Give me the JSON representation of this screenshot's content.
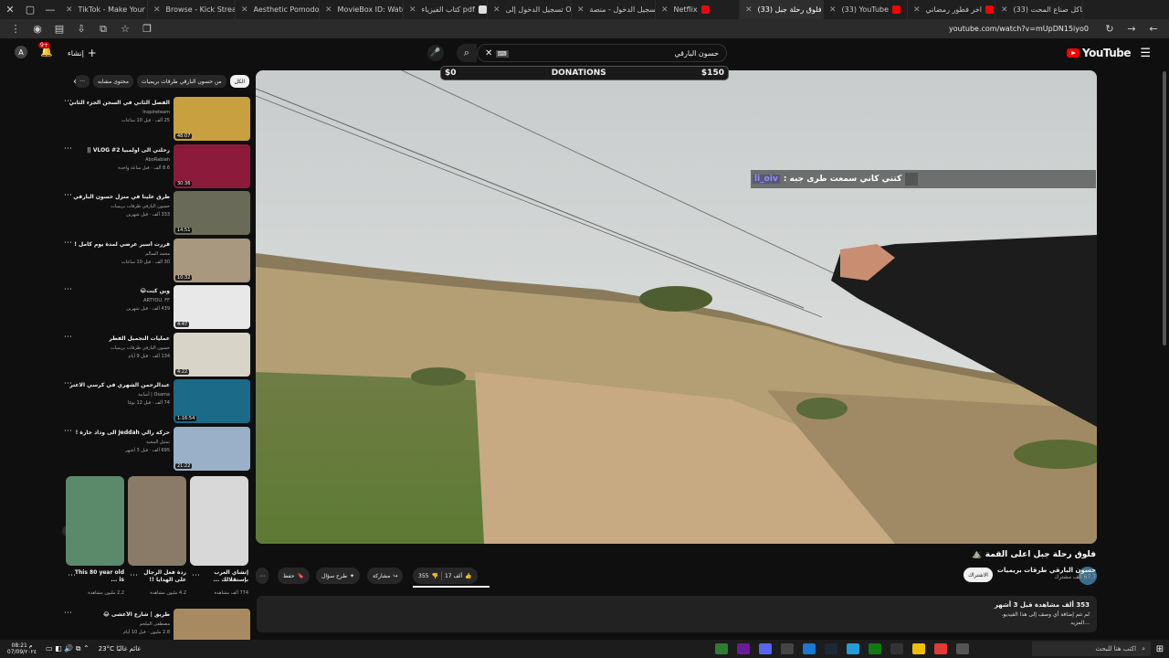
{
  "browser": {
    "tabs": [
      {
        "label": "TikTok - Make Your Da",
        "color": "#111111"
      },
      {
        "label": "Browse - Kick Stream",
        "color": "#53fc18"
      },
      {
        "label": "Aesthetic Pomodoro",
        "color": "#e8c43c"
      },
      {
        "label": "MovieBox ID: Watch M",
        "color": "#35a0c8"
      },
      {
        "label": "كتاب الفيزياء pdf",
        "color": "#e0e0e0"
      },
      {
        "label": "تسجيل الدخول إلى OSN",
        "color": "#5555aa"
      },
      {
        "label": "تسجيل الدخول - منصة",
        "color": "#555577"
      },
      {
        "label": "Netflix",
        "color": "#e50914"
      },
      {
        "label": "(33) فلوق رحلة جبل",
        "color": "#ff0000"
      },
      {
        "label": "(33) YouTube",
        "color": "#ff0000"
      },
      {
        "label": "اخر فطور رمضاني",
        "color": "#ff0000"
      },
      {
        "label": "(33) مشاكل صناع المحت",
        "color": "#ff0000"
      }
    ],
    "url": "youtube.com/watch?v=mUpDN15iyo0"
  },
  "header": {
    "logo_text": "YouTube",
    "search_value": "حسون البارقي",
    "avatar_letter": "A",
    "notification_count": "9+",
    "create_label": "إنشاء"
  },
  "chips": [
    "الكل",
    "من حسون البارقي طرقات بريميات",
    "محتوى مشابه"
  ],
  "recommendations": [
    {
      "title": "الفصل الثاني في السجن الجزء الثاني",
      "channel": "Inspireteam",
      "meta": "25 ألف · قبل 10 ساعات",
      "duration": "48:07",
      "thumb": "#c8a040"
    },
    {
      "title": "رحلتي الى اولمبيا VLOG #2 ||",
      "channel": "AboRabiah",
      "meta": "8.6 ألف · قبل ساعة واحدة",
      "duration": "30:36",
      "thumb": "#8c1a3a"
    },
    {
      "title": "طرق علينا في منزل حسون البارقي",
      "channel": "حسون البارقي طرقات بريميات",
      "meta": "333 ألف · قبل شهرين",
      "duration": "14:51",
      "thumb": "#6a6a58"
    },
    {
      "title": "قررت أسير عرضي لمدة يوم كامل !",
      "channel": "محمد السالم",
      "meta": "30 ألف · قبل 10 ساعات",
      "duration": "10:32",
      "thumb": "#a89880"
    },
    {
      "title": "وين كنت😂",
      "channel": "ARTYOU. FF",
      "meta": "439 ألف · قبل شهرين",
      "duration": "4:47",
      "thumb": "#e8e8e8"
    },
    {
      "title": "عمليات التجميل الفطر",
      "channel": "حسون البارقي طرقات بريميات",
      "meta": "134 ألف · قبل 9 أيام",
      "duration": "4:22",
      "thumb": "#d8d4c8"
    },
    {
      "title": "عبدالرحمن الشهري في كرسي الاعتراف !! 😱",
      "channel": "Osama | أسامة",
      "meta": "74 ألف · قبل 12 يومًا",
      "duration": "1:16:54",
      "thumb": "#1a6a88"
    },
    {
      "title": "حركة رالي Jeddah الى وداد حارة !",
      "channel": "تمثيل المحبة",
      "meta": "695 ألف · قبل 3 أشهر",
      "duration": "21:22",
      "thumb": "#9ab0c8"
    }
  ],
  "shorts": [
    {
      "title": "إتشاي العرب بإستقلالك ...",
      "views": "774 ألف مشاهدة",
      "color": "#d8d8d8"
    },
    {
      "title": "ردة فعل الرجال على الهدايا !!",
      "views": "4.2 مليون مشاهدة",
      "color": "#8a7a68"
    },
    {
      "title": "This 80 year old is ...",
      "views": "2.2 مليون مشاهدة",
      "color": "#5a8a6a"
    }
  ],
  "extra_rec": {
    "title": "طريق | شارع الأعشى 😂",
    "channel": "مصطفى الملحم",
    "meta": "2.8 مليون · قبل 10 أيام"
  },
  "video": {
    "donations_min": "$0",
    "donations_label": "DONATIONS",
    "donations_max": "$150",
    "chat_user": "li_oiv",
    "chat_text": "كتني كاني سمعت طرى جبه :",
    "title": "فلوق رحلة جبل اعلى القمة ⛰️",
    "channel_name": "حسون البارقي طرقات بريميات",
    "subscribers": "67.7 ألف مشترك",
    "join_label": "الاشتراك",
    "likes": "17 ألف",
    "dislikes": "355",
    "share_label": "مشاركة",
    "ask_label": "طرح سؤال",
    "save_label": "حفظ"
  },
  "description": {
    "views": "353 ألف مشاهدة  قبل 3 أشهر",
    "text": "لم تتم إضافة أي وصف إلى هذا الفيديو.",
    "more": "...المزيد"
  },
  "taskbar": {
    "weather": "23°C  غائم غالبًا",
    "search": "اكتب هنا للبحث",
    "time": "08:21 م",
    "date": "07/09/٢٠٢٤"
  }
}
